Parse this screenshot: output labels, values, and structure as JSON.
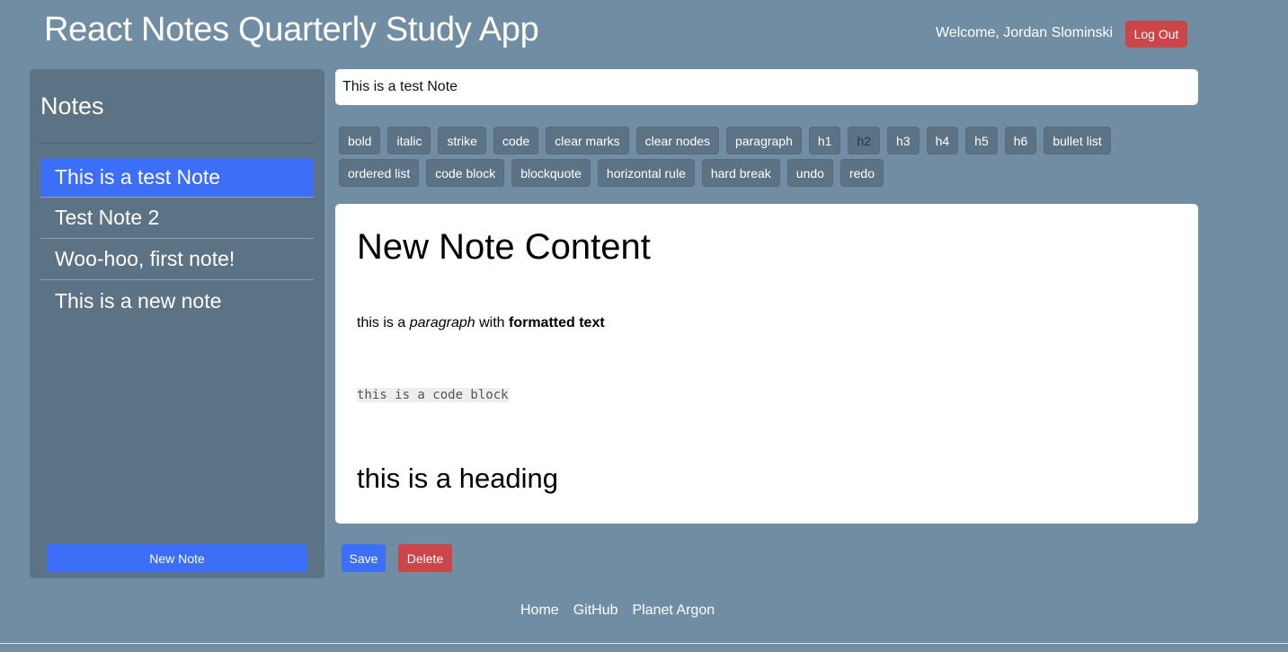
{
  "header": {
    "title": "React Notes Quarterly Study App",
    "welcome": "Welcome, Jordan Slominski",
    "logout_label": "Log Out"
  },
  "sidebar": {
    "title": "Notes",
    "notes": [
      {
        "title": "This is a test Note",
        "active": true
      },
      {
        "title": "Test Note 2",
        "active": false
      },
      {
        "title": "Woo-hoo, first note!",
        "active": false
      },
      {
        "title": "This is a new note",
        "active": false
      }
    ],
    "new_note_label": "New Note"
  },
  "editor": {
    "title_value": "This is a test Note",
    "toolbar": [
      {
        "label": "bold"
      },
      {
        "label": "italic"
      },
      {
        "label": "strike"
      },
      {
        "label": "code"
      },
      {
        "label": "clear marks"
      },
      {
        "label": "clear nodes"
      },
      {
        "label": "paragraph"
      },
      {
        "label": "h1"
      },
      {
        "label": "h2",
        "active": true
      },
      {
        "label": "h3"
      },
      {
        "label": "h4"
      },
      {
        "label": "h5"
      },
      {
        "label": "h6"
      },
      {
        "label": "bullet list"
      },
      {
        "label": "ordered list"
      },
      {
        "label": "code block"
      },
      {
        "label": "blockquote"
      },
      {
        "label": "horizontal rule"
      },
      {
        "label": "hard break"
      },
      {
        "label": "undo"
      },
      {
        "label": "redo"
      }
    ],
    "content": {
      "heading1": "New Note Content",
      "paragraph": {
        "prefix": "this is a ",
        "italic": "paragraph",
        "middle": " with ",
        "bold": "formatted text"
      },
      "code_block": "this is a code block",
      "heading2": "this is a heading"
    },
    "save_label": "Save",
    "delete_label": "Delete"
  },
  "footer": {
    "links": [
      {
        "label": "Home"
      },
      {
        "label": "GitHub"
      },
      {
        "label": "Planet Argon"
      }
    ]
  },
  "colors": {
    "background": "#718da3",
    "sidebar": "#5c7285",
    "primary": "#3d6ef7",
    "danger": "#cc4549"
  }
}
